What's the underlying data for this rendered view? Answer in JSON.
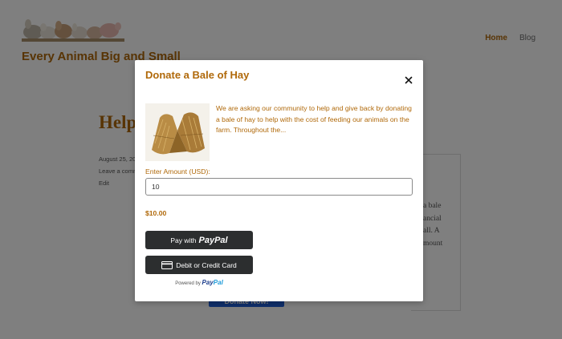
{
  "site": {
    "title": "Every Animal Big and Small",
    "nav": [
      {
        "label": "Home"
      },
      {
        "label": "Blog"
      }
    ]
  },
  "post": {
    "title_partial": "Help",
    "meta": {
      "date_partial": "August 25, 20",
      "comment_partial": "Leave a comm",
      "edit": "Edit"
    },
    "side_text_lines": [
      "a bale",
      "",
      "ancial",
      "all. A",
      "mount"
    ],
    "donate_now_partial": "Donate Now!"
  },
  "modal": {
    "title": "Donate a Bale of Hay",
    "description": "We are asking our community to help and give back by donating a bale of hay to help with the cost of feeding our animals on the farm. Throughout the...",
    "amount_label": "Enter Amount (USD):",
    "amount_value": "10",
    "total": "$10.00",
    "paypal_button": {
      "prefix": "Pay with",
      "brand": "PayPal"
    },
    "card_button": {
      "label": "Debit or Credit Card",
      "icon": "credit-card-icon"
    },
    "powered_by": {
      "prefix": "Powered by",
      "brand_pay": "Pay",
      "brand_pal": "Pal"
    }
  },
  "colors": {
    "accent": "#b0690a",
    "paypal_button_bg": "#2c2e2f",
    "overlay": "rgba(0,0,0,0.5)"
  }
}
